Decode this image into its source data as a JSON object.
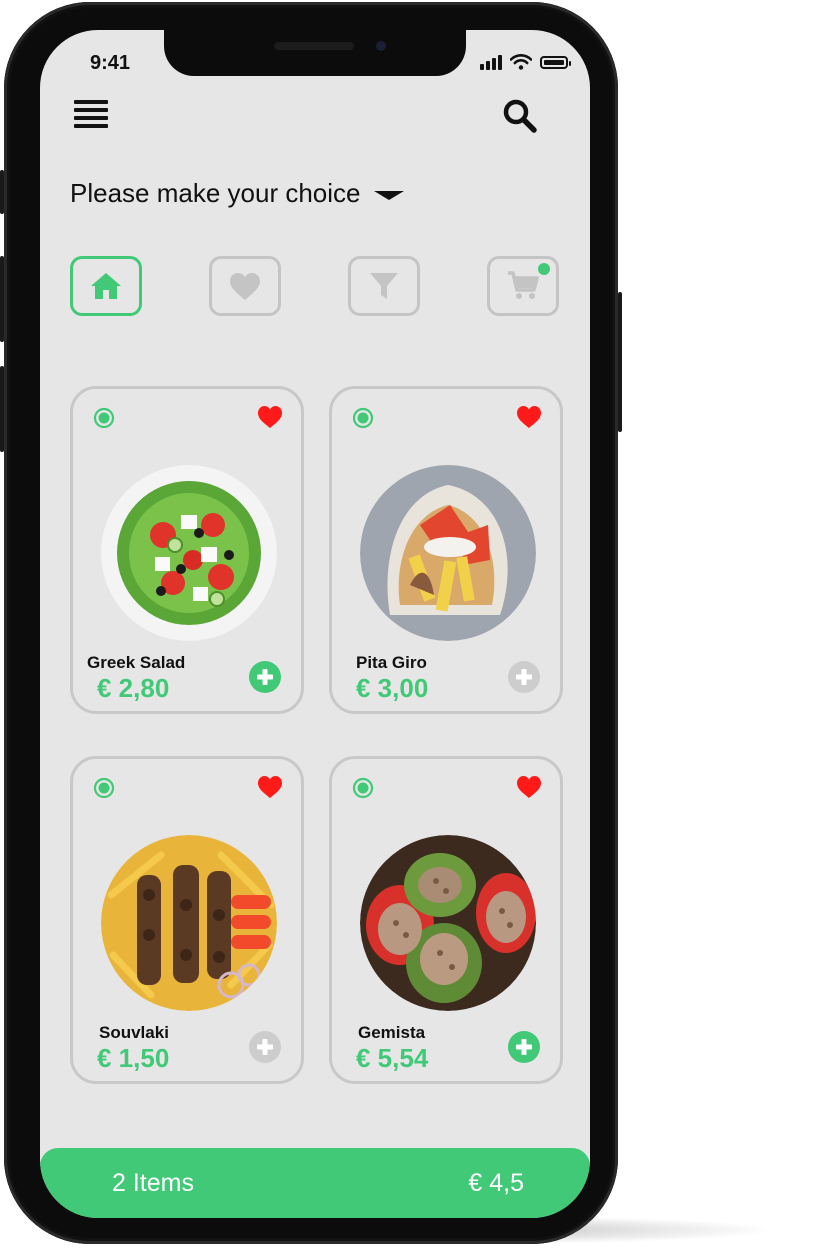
{
  "status_bar": {
    "time": "9:41"
  },
  "header": {
    "choice_label": "Please make your choice"
  },
  "tabs": [
    {
      "name": "home",
      "icon": "home-icon",
      "active": true
    },
    {
      "name": "favorites",
      "icon": "heart-icon",
      "active": false
    },
    {
      "name": "filter",
      "icon": "filter-icon",
      "active": false
    },
    {
      "name": "cart",
      "icon": "cart-icon",
      "active": false,
      "has_badge": true
    }
  ],
  "products": [
    {
      "name": "Greek Salad",
      "price": "€ 2,80",
      "favorite": true,
      "added": true
    },
    {
      "name": "Pita Giro",
      "price": "€ 3,00",
      "favorite": true,
      "added": false
    },
    {
      "name": "Souvlaki",
      "price": "€ 1,50",
      "favorite": true,
      "added": false
    },
    {
      "name": "Gemista",
      "price": "€ 5,54",
      "favorite": true,
      "added": true
    }
  ],
  "cart_bar": {
    "items_label": "2 Items",
    "total": "€ 4,5"
  },
  "colors": {
    "accent": "#41c977",
    "heart": "#ff1a1a",
    "inactive": "#c4c4c4",
    "background": "#e6e6e6"
  }
}
